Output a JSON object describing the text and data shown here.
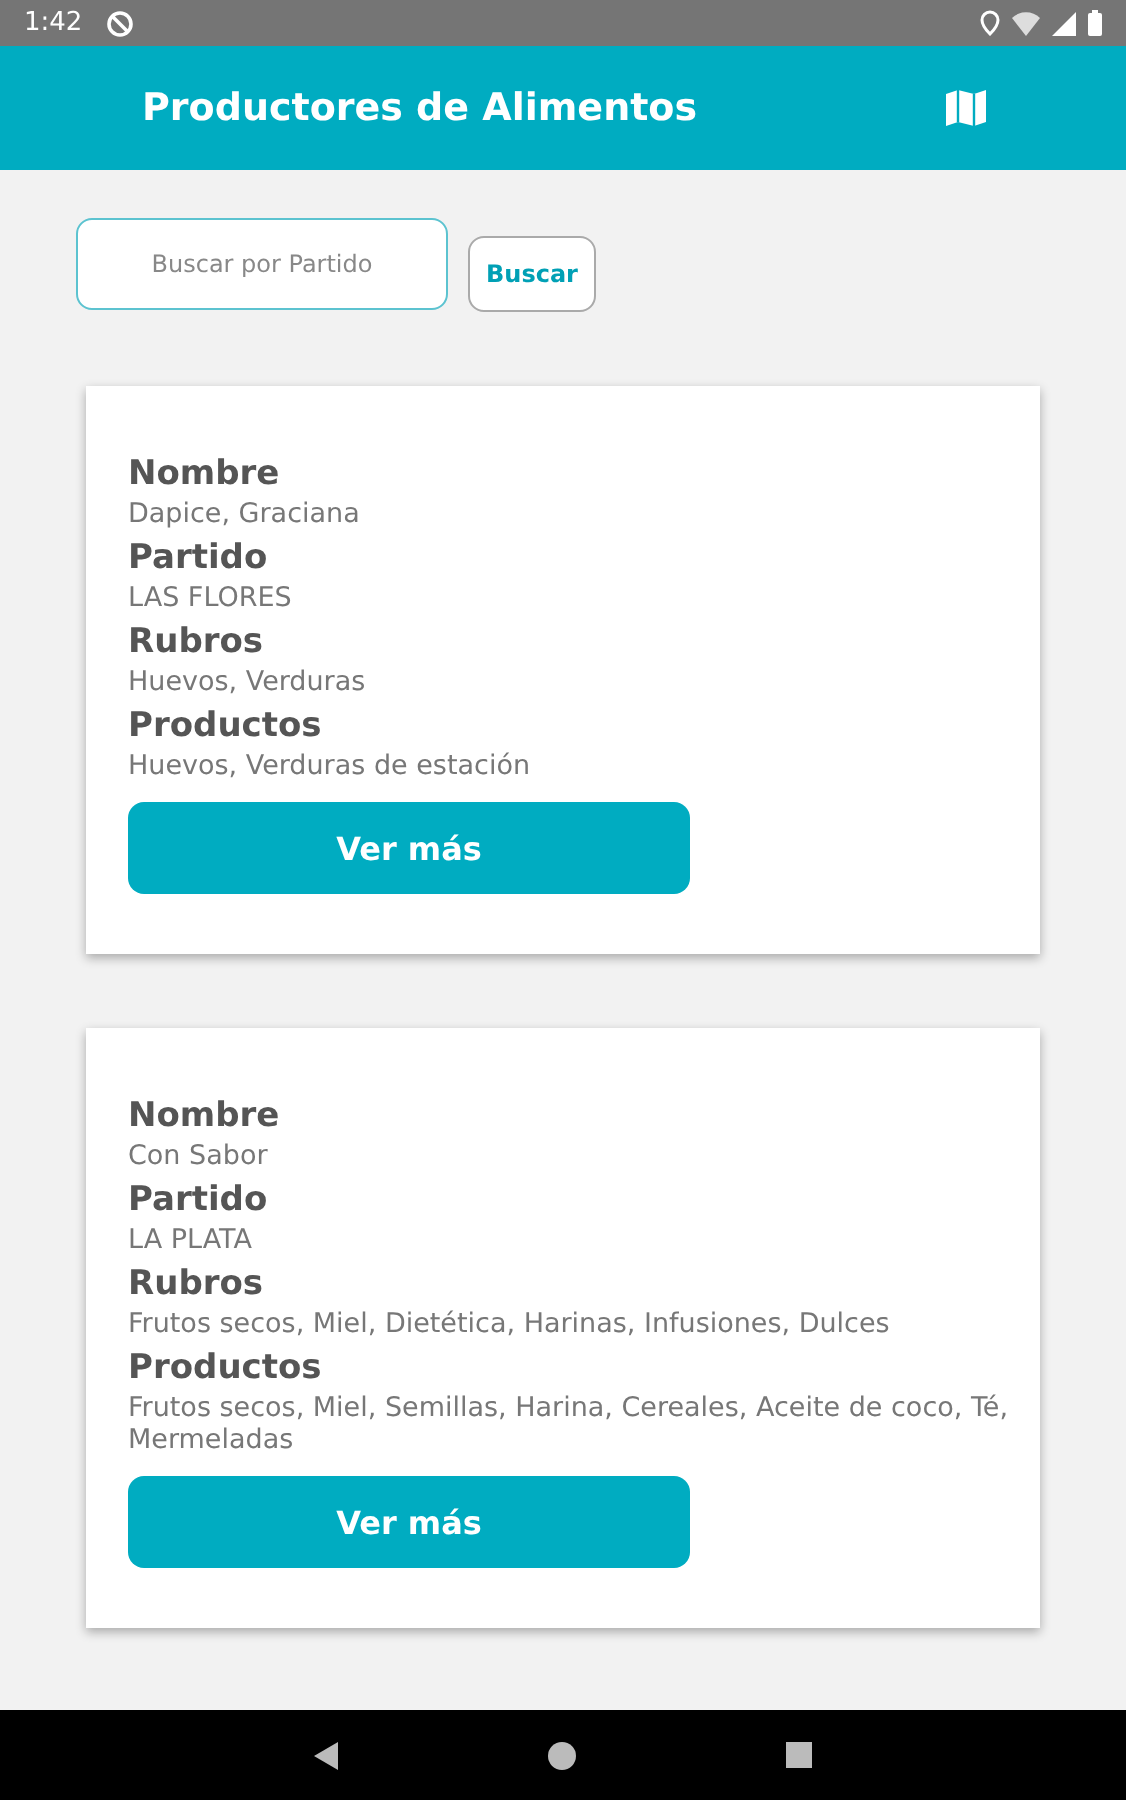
{
  "status_bar": {
    "time": "1:42"
  },
  "app_bar": {
    "title": "Productores de Alimentos"
  },
  "search": {
    "placeholder": "Buscar por Partido",
    "button": "Buscar"
  },
  "producers": [
    {
      "fields": [
        {
          "label": "Nombre",
          "value": "Dapice, Graciana"
        },
        {
          "label": "Partido",
          "value": "LAS FLORES"
        },
        {
          "label": "Rubros",
          "value": "Huevos, Verduras"
        },
        {
          "label": "Productos",
          "value": "Huevos, Verduras de estación"
        }
      ],
      "button": "Ver más"
    },
    {
      "fields": [
        {
          "label": "Nombre",
          "value": "Con Sabor"
        },
        {
          "label": "Partido",
          "value": "LA PLATA"
        },
        {
          "label": "Rubros",
          "value": "Frutos secos, Miel, Dietética, Harinas, Infusiones, Dulces"
        },
        {
          "label": "Productos",
          "value": "Frutos secos, Miel, Semillas, Harina, Cereales, Aceite de coco, Té, Mermeladas"
        }
      ],
      "button": "Ver más"
    }
  ]
}
